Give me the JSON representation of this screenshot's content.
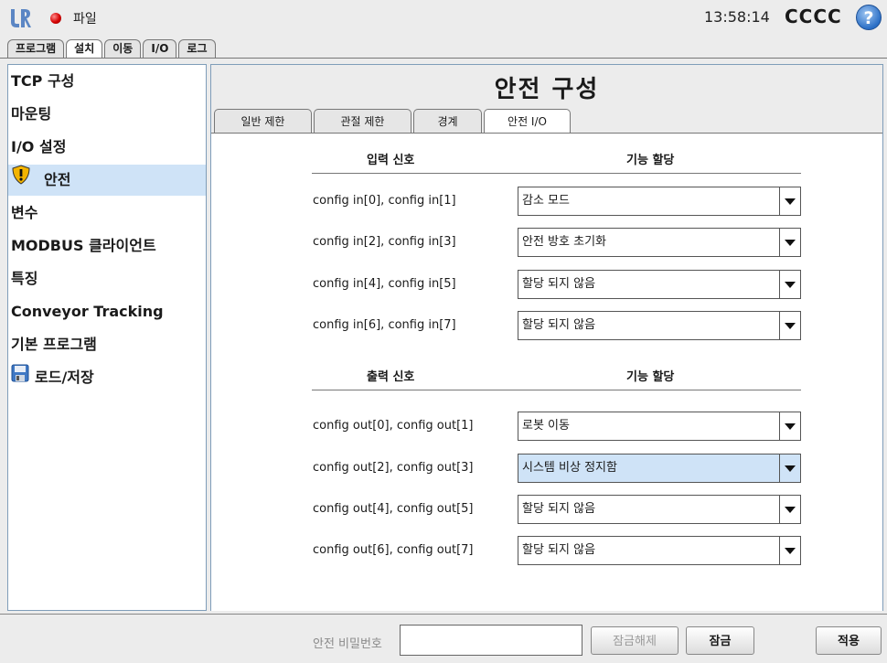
{
  "topbar": {
    "file_label": "파일",
    "time": "13:58:14",
    "robot_name": "CCCC",
    "help_symbol": "?",
    "status_color": "#d40000"
  },
  "main_tabs": [
    {
      "label": "프로그램",
      "active": false
    },
    {
      "label": "설치",
      "active": true
    },
    {
      "label": "이동",
      "active": false
    },
    {
      "label": "I/O",
      "active": false
    },
    {
      "label": "로그",
      "active": false
    }
  ],
  "sidebar": {
    "items": [
      {
        "label": "TCP 구성"
      },
      {
        "label": "마운팅"
      },
      {
        "label": "I/O 설정"
      },
      {
        "label": "안전",
        "icon": "warning-shield-icon",
        "selected": true
      },
      {
        "label": "변수"
      },
      {
        "label": "MODBUS 클라이언트"
      },
      {
        "label": "특징"
      },
      {
        "label": "Conveyor Tracking"
      },
      {
        "label": "기본 프로그램"
      },
      {
        "label": "로드/저장",
        "icon": "save-disk-icon"
      }
    ]
  },
  "main": {
    "title": "안전 구성",
    "sub_tabs": [
      {
        "label": "일반 제한",
        "active": false
      },
      {
        "label": "관절 제한",
        "active": false
      },
      {
        "label": "경계",
        "active": false
      },
      {
        "label": "안전 I/O",
        "active": true
      }
    ],
    "input_section": {
      "header_signal": "입력 신호",
      "header_function": "기능 할당",
      "rows": [
        {
          "signal": "config in[0], config in[1]",
          "function": "감소 모드"
        },
        {
          "signal": "config in[2], config in[3]",
          "function": "안전 방호 초기화"
        },
        {
          "signal": "config in[4], config in[5]",
          "function": "할당 되지 않음"
        },
        {
          "signal": "config in[6], config in[7]",
          "function": "할당 되지 않음"
        }
      ]
    },
    "output_section": {
      "header_signal": "출력 신호",
      "header_function": "기능 할당",
      "rows": [
        {
          "signal": "config out[0], config out[1]",
          "function": "로봇 이동"
        },
        {
          "signal": "config out[2], config out[3]",
          "function": "시스템 비상 정지함",
          "highlighted": true
        },
        {
          "signal": "config out[4], config out[5]",
          "function": "할당 되지 않음"
        },
        {
          "signal": "config out[6], config out[7]",
          "function": "할당 되지 않음"
        }
      ]
    }
  },
  "bottom": {
    "password_label": "안전 비밀번호",
    "password_value": "",
    "unlock_label": "잠금해제",
    "lock_label": "잠금",
    "apply_label": "적용"
  }
}
